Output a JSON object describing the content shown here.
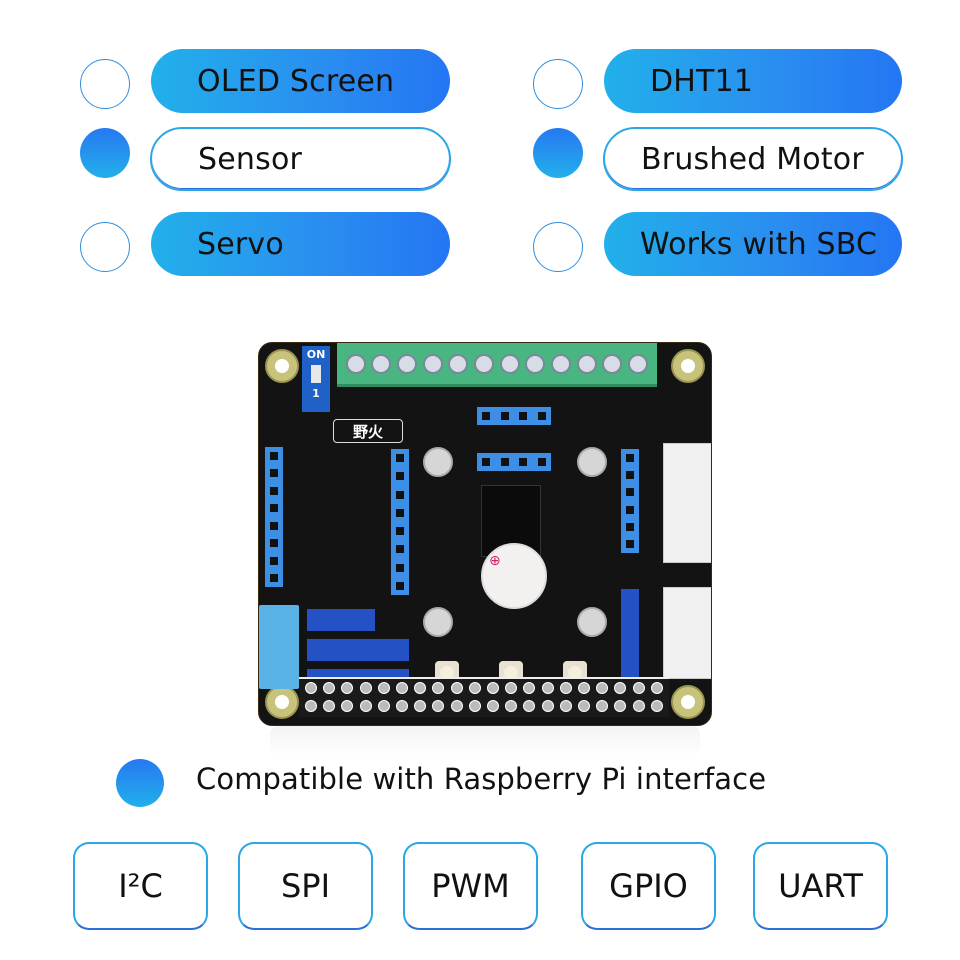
{
  "features": {
    "left": [
      {
        "label": "OLED Screen",
        "selected": false,
        "style": "filled"
      },
      {
        "label": "Sensor",
        "selected": true,
        "style": "outline"
      },
      {
        "label": "Servo",
        "selected": false,
        "style": "filled"
      }
    ],
    "right": [
      {
        "label": "DHT11",
        "selected": false,
        "style": "filled"
      },
      {
        "label": "Brushed Motor",
        "selected": true,
        "style": "outline"
      },
      {
        "label": "Works with SBC",
        "selected": false,
        "style": "filled"
      }
    ]
  },
  "board": {
    "dip_label_top": "ON",
    "dip_label_bottom": "1",
    "logo_text": "野火",
    "image_alt": "Expansion board for Raspberry Pi"
  },
  "compatibility": {
    "text": "Compatible with Raspberry Pi interface"
  },
  "interfaces": [
    {
      "label": "I²C"
    },
    {
      "label": "SPI"
    },
    {
      "label": "PWM"
    },
    {
      "label": "GPIO"
    },
    {
      "label": "UART"
    }
  ],
  "colors": {
    "accent_start": "#22b0ea",
    "accent_end": "#2476f3",
    "outline": "#2ba6e6",
    "board": "#131313",
    "terminal": "#49b682",
    "header": "#3d8fe6"
  }
}
